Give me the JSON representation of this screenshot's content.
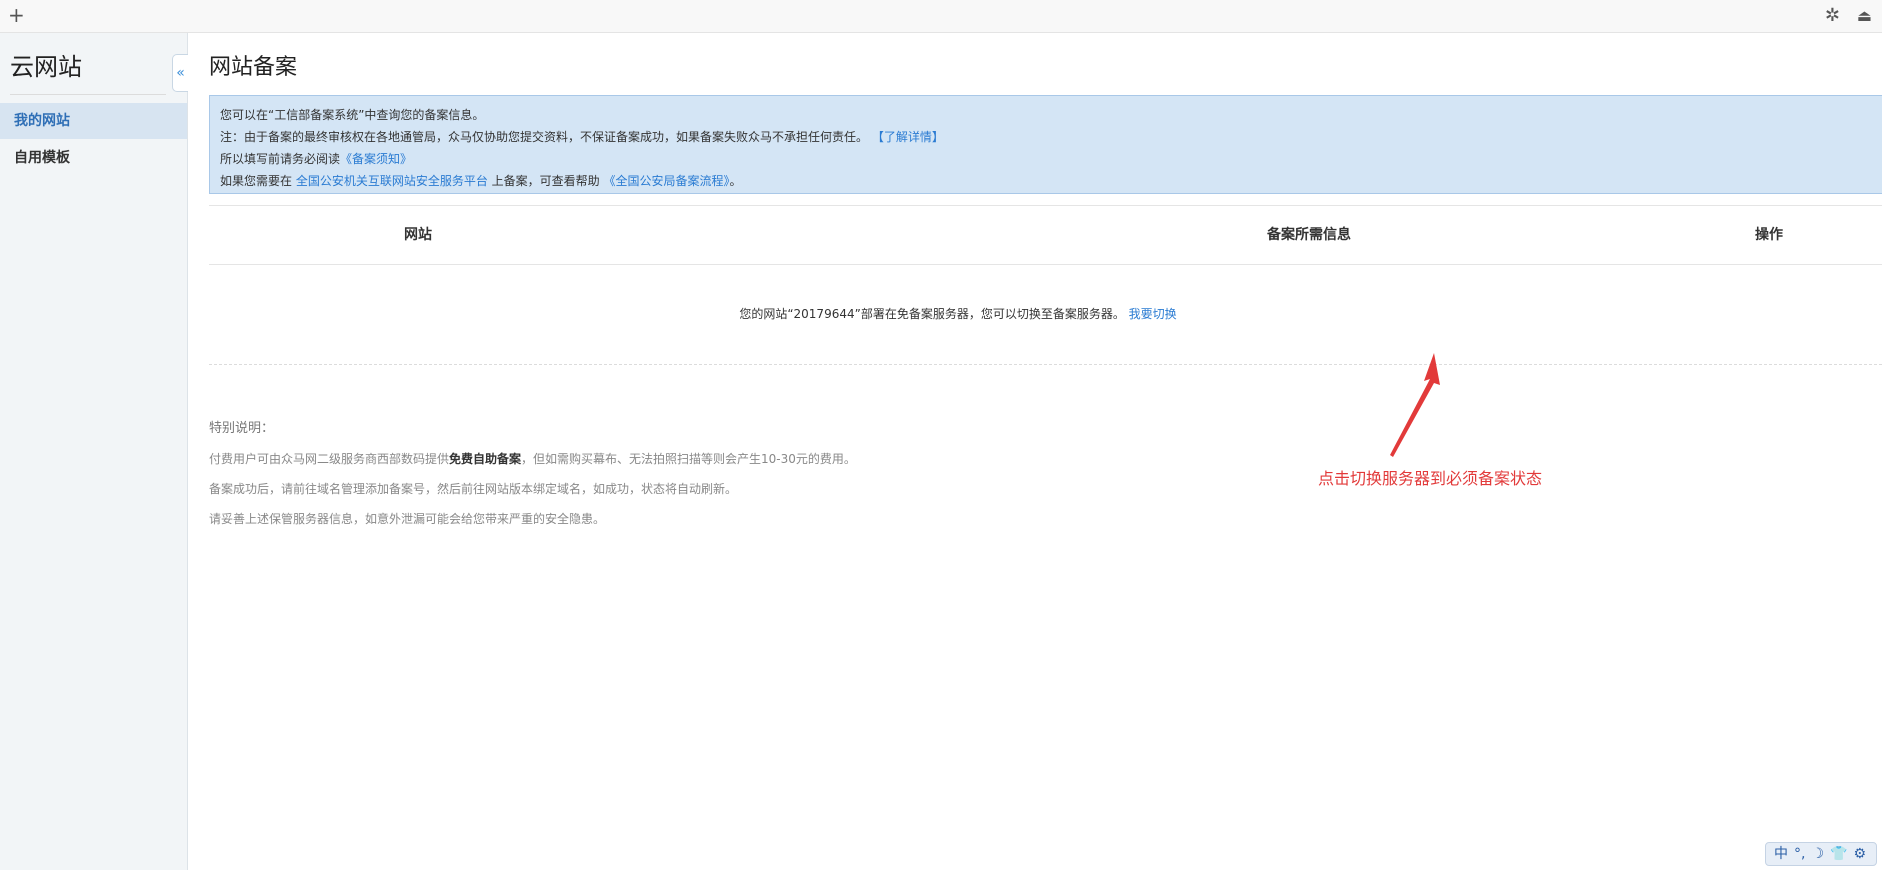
{
  "topbar": {
    "plus_icon": "+",
    "star_icon": "✲",
    "eject_icon": "⏏"
  },
  "sidebar": {
    "brand": "云网站",
    "collapse_icon": "«",
    "items": [
      {
        "label": "我的网站",
        "active": true
      },
      {
        "label": "自用模板",
        "active": false
      }
    ]
  },
  "main": {
    "title": "网站备案",
    "notice": {
      "line1": "您可以在“工信部备案系统”中查询您的备案信息。",
      "line2_text": "注：由于备案的最终审核权在各地通管局，众马仅协助您提交资料，不保证备案成功，如果备案失败众马不承担任何责任。",
      "line2_link": "【了解详情】",
      "line3_text": "所以填写前请务必阅读",
      "line3_link": "《备案须知》",
      "line4_text_a": "如果您需要在 ",
      "line4_link_a": "全国公安机关互联网站安全服务平台",
      "line4_text_b": " 上备案，可查看帮助 ",
      "line4_link_b": "《全国公安局备案流程》",
      "line4_text_c": "。"
    },
    "table": {
      "headers": [
        "网站",
        "备案所需信息",
        "操作"
      ],
      "row_message": "您的网站“20179644”部署在免备案服务器，您可以切换至备案服务器。",
      "row_link": "我要切换"
    },
    "notes": {
      "title": "特别说明：",
      "line1_a": "付费用户可由众马网二级服务商西部数码提供",
      "line1_bold": "免费自助备案",
      "line1_b": "，但如需购买幕布、无法拍照扫描等则会产生10-30元的费用。",
      "line2": "备案成功后，请前往域名管理添加备案号，然后前往网站版本绑定域名，如成功，状态将自动刷新。",
      "line3": "请妥善上述保管服务器信息，如意外泄漏可能会给您带来严重的安全隐患。"
    },
    "annotation": "点击切换服务器到必须备案状态"
  },
  "ime": {
    "items": [
      "中",
      "°,",
      "☽",
      "👕",
      "⚙"
    ]
  },
  "colors": {
    "link": "#2a7bd2",
    "notice_bg": "#d4e5f5",
    "annotation": "#e23a3a",
    "active_nav": "#2f6fb6"
  }
}
